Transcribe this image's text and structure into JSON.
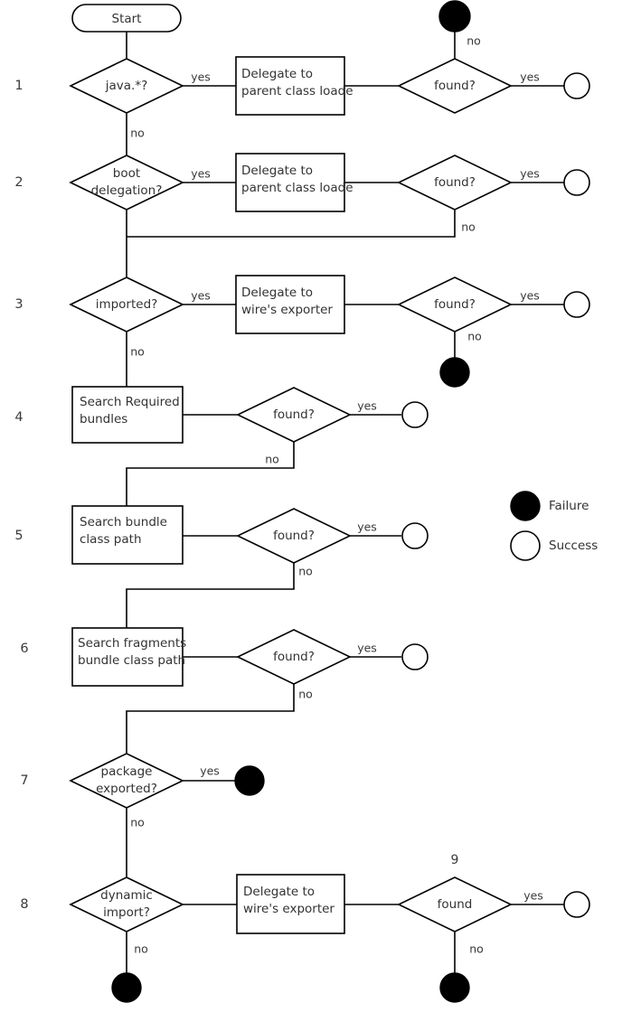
{
  "diagram": {
    "title": "OSGi class loading flowchart",
    "colors": {
      "stroke": "#000000",
      "fill": "#ffffff",
      "failure": "#000000",
      "success": "#ffffff",
      "text": "#333333"
    },
    "start": {
      "label": "Start"
    },
    "row_numbers": [
      "1",
      "2",
      "3",
      "4",
      "5",
      "6",
      "7",
      "8"
    ],
    "step_tag_9": "9",
    "edge_labels": {
      "yes": "yes",
      "no": "no"
    },
    "rows": [
      {
        "number": "1",
        "decision": "java.*?",
        "action": "Delegate to parent class loade",
        "action_line1": "Delegate to",
        "action_line2": "parent class loade",
        "check": "found?",
        "yes_label": "yes",
        "no_label": "no",
        "check_yes_label": "yes",
        "check_no_label": "no",
        "check_yes_outcome": "success",
        "check_no_outcome": "failure"
      },
      {
        "number": "2",
        "decision_line1": "boot",
        "decision_line2": "delegation?",
        "action_line1": "Delegate to",
        "action_line2": "parent class loade",
        "check": "found?",
        "yes_label": "yes",
        "no_label": "no",
        "check_yes_label": "yes",
        "check_no_label": "no",
        "check_yes_outcome": "success",
        "check_no_outcome": "continue"
      },
      {
        "number": "3",
        "decision": "imported?",
        "action_line1": "Delegate to",
        "action_line2": "wire's exporter",
        "check": "found?",
        "yes_label": "yes",
        "no_label": "no",
        "check_yes_label": "yes",
        "check_no_label": "no",
        "check_yes_outcome": "success",
        "check_no_outcome": "failure"
      },
      {
        "number": "4",
        "action_line1": "Search Required",
        "action_line2": "bundles",
        "check": "found?",
        "check_yes_label": "yes",
        "check_no_label": "no",
        "check_yes_outcome": "success",
        "check_no_outcome": "continue"
      },
      {
        "number": "5",
        "action_line1": "Search bundle",
        "action_line2": "class path",
        "check": "found?",
        "check_yes_label": "yes",
        "check_no_label": "no",
        "check_yes_outcome": "success",
        "check_no_outcome": "continue"
      },
      {
        "number": "6",
        "action_line1": "Search fragments",
        "action_line2": "bundle class path",
        "check": "found?",
        "check_yes_label": "yes",
        "check_no_label": "no",
        "check_yes_outcome": "success",
        "check_no_outcome": "continue"
      },
      {
        "number": "7",
        "decision_line1": "package",
        "decision_line2": "exported?",
        "yes_label": "yes",
        "no_label": "no",
        "yes_outcome": "failure",
        "no_outcome": "continue"
      },
      {
        "number": "8",
        "decision_line1": "dynamic",
        "decision_line2": "import?",
        "action_line1": "Delegate to",
        "action_line2": "wire's exporter",
        "check": "found",
        "check_tag": "9",
        "no_label": "no",
        "check_yes_label": "yes",
        "check_no_label": "no",
        "no_outcome": "failure",
        "check_yes_outcome": "success",
        "check_no_outcome": "failure"
      }
    ],
    "legend": {
      "items": [
        {
          "marker": "failure-circle-icon",
          "label": "Failure"
        },
        {
          "marker": "success-circle-icon",
          "label": "Success"
        }
      ]
    }
  }
}
